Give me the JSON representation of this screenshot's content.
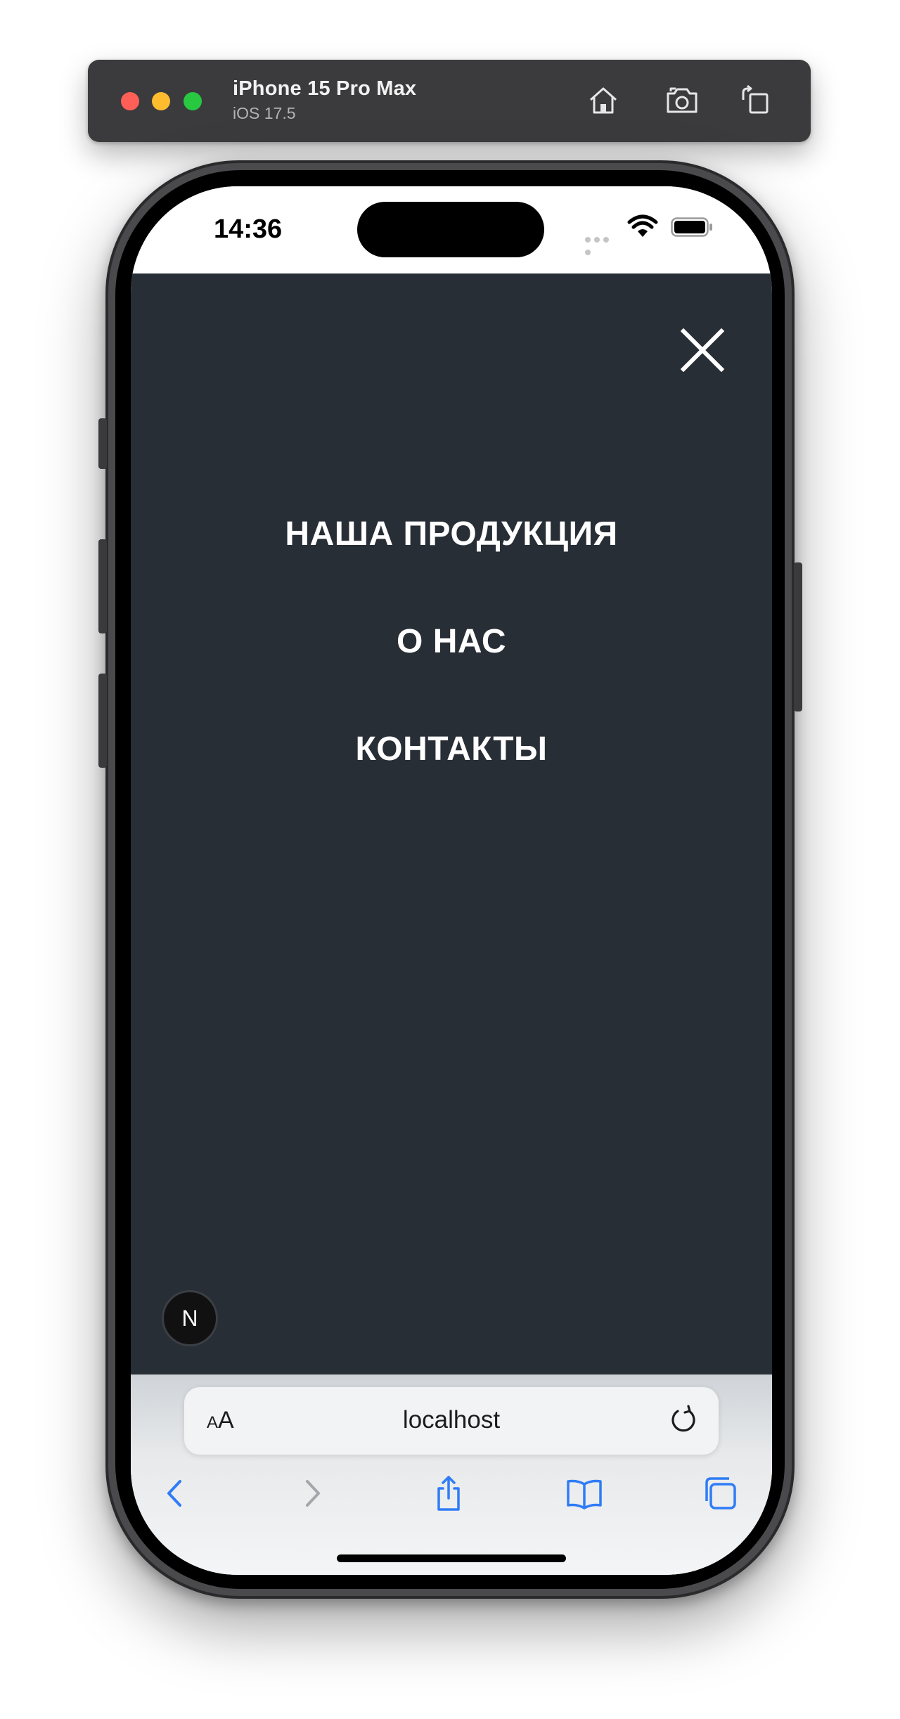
{
  "simulator": {
    "device_name": "iPhone 15 Pro Max",
    "os_version": "iOS 17.5",
    "toolbar_icons": [
      "home-icon",
      "screenshot-icon",
      "rotate-icon"
    ]
  },
  "status_bar": {
    "time": "14:36",
    "icons": [
      "signal-dots-icon",
      "wifi-icon",
      "battery-icon"
    ]
  },
  "menu": {
    "close_icon": "close-icon",
    "items": [
      {
        "label": "НАША ПРОДУКЦИЯ"
      },
      {
        "label": "О НАС"
      },
      {
        "label": "КОНТАКТЫ"
      }
    ]
  },
  "dev_badge": {
    "label": "N"
  },
  "browser": {
    "text_size_label_small": "A",
    "text_size_label_large": "A",
    "url": "localhost",
    "bottom_icons": [
      "back-icon",
      "forward-icon",
      "share-icon",
      "bookmarks-icon",
      "tabs-icon"
    ]
  },
  "colors": {
    "menu_background": "#282e35",
    "menu_text": "#ffffff",
    "link_blue": "#2f7cf6",
    "toolbar_background": "#3b3b3d"
  }
}
